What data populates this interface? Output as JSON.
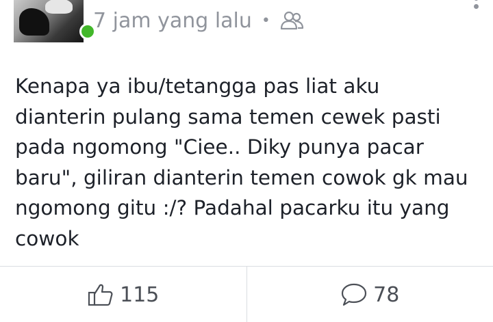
{
  "post": {
    "timestamp": "7 jam yang lalu",
    "separator": "•",
    "audience_icon": "friends-icon",
    "more_icon": "more-vertical-icon",
    "text_lines": [
      "Kenapa ya ibu/tetangga pas liat aku",
      "dianterin pulang sama temen cewek pasti",
      "pada ngomong \"Ciee.. Diky punya pacar",
      "baru\", giliran dianterin temen cowok gk mau",
      "ngomong gitu :/? Padahal pacarku itu yang",
      "cowok"
    ]
  },
  "actions": {
    "like_icon": "thumbs-up-icon",
    "like_count": "115",
    "comment_icon": "comment-bubble-icon",
    "comment_count": "78"
  },
  "colors": {
    "online_status": "#42b72a",
    "meta_text": "#90949c",
    "body_text": "#1d2129",
    "divider": "#dadde1"
  }
}
